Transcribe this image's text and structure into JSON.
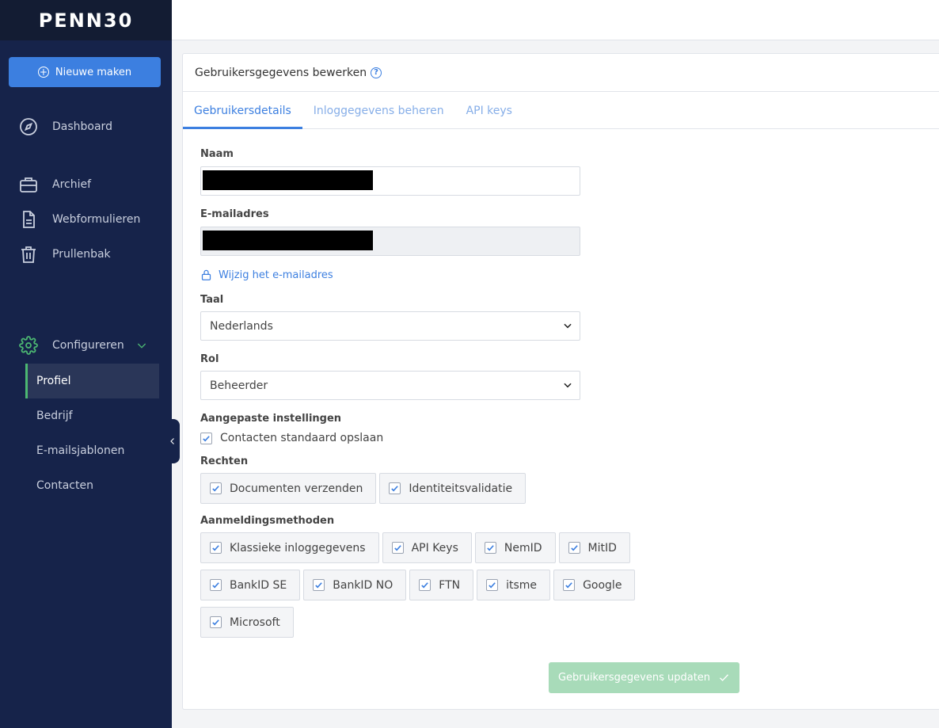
{
  "brand": {
    "logo": "PENN30"
  },
  "sidebar": {
    "new_button": "Nieuwe maken",
    "items": [
      {
        "label": "Dashboard"
      },
      {
        "label": "Archief"
      },
      {
        "label": "Webformulieren"
      },
      {
        "label": "Prullenbak"
      }
    ],
    "configure": {
      "label": "Configureren"
    },
    "sub_items": [
      {
        "label": "Profiel",
        "active": true
      },
      {
        "label": "Bedrijf"
      },
      {
        "label": "E-mailsjablonen"
      },
      {
        "label": "Contacten"
      }
    ]
  },
  "card": {
    "title": "Gebruikersgegevens bewerken",
    "tabs": [
      {
        "label": "Gebruikersdetails",
        "active": true
      },
      {
        "label": "Inloggegevens beheren"
      },
      {
        "label": "API keys"
      }
    ]
  },
  "form": {
    "name_label": "Naam",
    "email_label": "E-mailadres",
    "change_email_link": "Wijzig het e-mailadres",
    "language_label": "Taal",
    "language_value": "Nederlands",
    "role_label": "Rol",
    "role_value": "Beheerder",
    "custom_settings_label": "Aangepaste instellingen",
    "save_contacts_label": "Contacten standaard opslaan",
    "rights_label": "Rechten",
    "rights": [
      "Documenten verzenden",
      "Identiteitsvalidatie"
    ],
    "login_methods_label": "Aanmeldingsmethoden",
    "login_methods": [
      "Klassieke inloggegevens",
      "API Keys",
      "NemID",
      "MitID",
      "BankID SE",
      "BankID NO",
      "FTN",
      "itsme",
      "Google",
      "Microsoft"
    ],
    "submit_label": "Gebruikersgegevens updaten"
  },
  "colors": {
    "sidebar_bg": "#16234a",
    "accent": "#3c7fe0",
    "success": "#a8dbb9",
    "config_green": "#4cb872"
  }
}
